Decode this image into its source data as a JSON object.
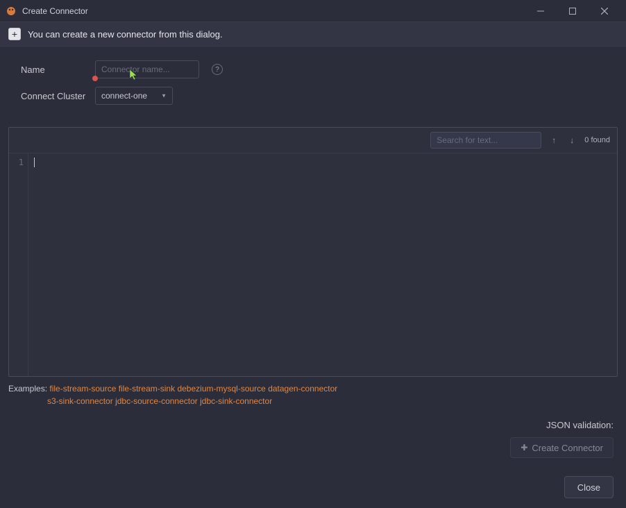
{
  "titlebar": {
    "title": "Create Connector"
  },
  "info": {
    "text": "You can create a new connector from this dialog."
  },
  "form": {
    "name_label": "Name",
    "name_placeholder": "Connector name...",
    "cluster_label": "Connect Cluster",
    "cluster_value": "connect-one"
  },
  "editor": {
    "search_placeholder": "Search for text...",
    "found_label": "0 found",
    "line_number": "1"
  },
  "examples": {
    "label": "Examples:",
    "links": [
      "file-stream-source",
      "file-stream-sink",
      "debezium-mysql-source",
      "datagen-connector",
      "s3-sink-connector",
      "jdbc-source-connector",
      "jdbc-sink-connector"
    ]
  },
  "validation": {
    "label": "JSON validation:"
  },
  "buttons": {
    "create": "Create Connector",
    "close": "Close"
  }
}
